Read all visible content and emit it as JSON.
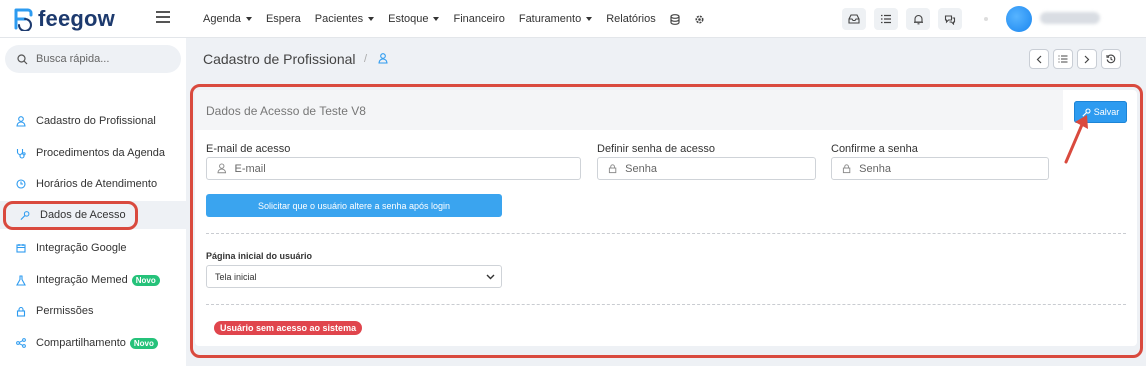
{
  "app": {
    "brand": "feegow"
  },
  "nav": {
    "items": [
      {
        "label": "Agenda",
        "dropdown": true
      },
      {
        "label": "Espera",
        "dropdown": false
      },
      {
        "label": "Pacientes",
        "dropdown": true
      },
      {
        "label": "Estoque",
        "dropdown": true
      },
      {
        "label": "Financeiro",
        "dropdown": false
      },
      {
        "label": "Faturamento",
        "dropdown": true
      },
      {
        "label": "Relatórios",
        "dropdown": false
      }
    ]
  },
  "search": {
    "placeholder": "Busca rápida..."
  },
  "sidebar": {
    "items": [
      {
        "label": "Cadastro do Profissional",
        "icon": "user-icon"
      },
      {
        "label": "Procedimentos da Agenda",
        "icon": "stethoscope-icon"
      },
      {
        "label": "Horários de Atendimento",
        "icon": "clock-icon"
      },
      {
        "label": "Dados de Acesso",
        "icon": "key-icon",
        "active": true
      },
      {
        "label": "Integração Google",
        "icon": "calendar-icon"
      },
      {
        "label": "Integração Memed",
        "icon": "flask-icon",
        "badge": "Novo"
      },
      {
        "label": "Permissões",
        "icon": "lock-icon"
      },
      {
        "label": "Compartilhamento",
        "icon": "share-icon",
        "badge": "Novo"
      }
    ]
  },
  "header": {
    "title": "Cadastro de Profissional",
    "separator": "/"
  },
  "panel": {
    "title": "Dados de Acesso de Teste V8",
    "save_label": "Salvar",
    "email_label": "E-mail de acesso",
    "email_placeholder": "E-mail",
    "password_label": "Definir senha de acesso",
    "password_placeholder": "Senha",
    "confirm_label": "Confirme a senha",
    "confirm_placeholder": "Senha",
    "change_password_button": "Solicitar que o usuário altere a senha após login",
    "home_label": "Página inicial do usuário",
    "home_value": "Tela inicial",
    "status": "Usuário sem acesso ao sistema"
  },
  "colors": {
    "accent": "#2d9bf0",
    "highlight": "#d94a3e",
    "badge_green": "#25c27a",
    "status_red": "#e0454d",
    "brand": "#1d3a6e"
  }
}
